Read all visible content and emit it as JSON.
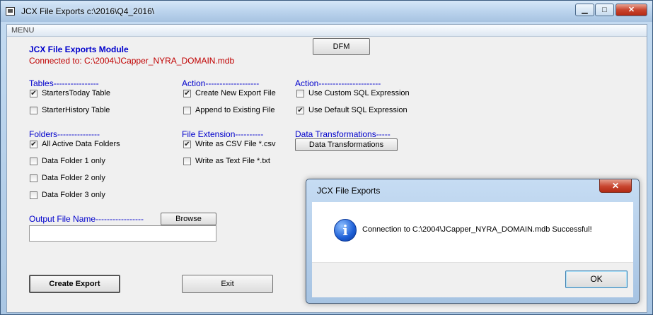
{
  "window": {
    "title": "JCX File Exports c:\\2016\\Q4_2016\\",
    "controls": {
      "minimize": "▁",
      "maximize": "□",
      "close": "✕"
    }
  },
  "menu": {
    "label": "MENU"
  },
  "module": {
    "title": "JCX File Exports Module",
    "connected": "Connected to: C:\\2004\\JCapper_NYRA_DOMAIN.mdb",
    "dfm_button": "DFM"
  },
  "tables": {
    "heading": "Tables----------------",
    "items": [
      {
        "label": "StartersToday Table",
        "checked": true
      },
      {
        "label": "StarterHistory Table",
        "checked": false
      }
    ]
  },
  "action1": {
    "heading": "Action-------------------",
    "items": [
      {
        "label": "Create New Export File",
        "checked": true
      },
      {
        "label": "Append to Existing File",
        "checked": false
      }
    ]
  },
  "action2": {
    "heading": "Action----------------------",
    "items": [
      {
        "label": "Use Custom SQL Expression",
        "checked": false
      },
      {
        "label": "Use Default SQL Expression",
        "checked": true
      }
    ]
  },
  "folders": {
    "heading": "Folders---------------",
    "items": [
      {
        "label": "All Active Data Folders",
        "checked": true
      },
      {
        "label": "Data Folder 1 only",
        "checked": false
      },
      {
        "label": "Data Folder 2 only",
        "checked": false
      },
      {
        "label": "Data Folder 3 only",
        "checked": false
      }
    ]
  },
  "file_extension": {
    "heading": "File Extension----------",
    "items": [
      {
        "label": "Write as CSV File  *.csv",
        "checked": true
      },
      {
        "label": "Write as Text File *.txt",
        "checked": false
      }
    ]
  },
  "transformations": {
    "heading": "Data Transformations-----",
    "button": "Data Transformations"
  },
  "output": {
    "label": "Output File Name-----------------",
    "browse_button": "Browse",
    "value": ""
  },
  "buttons": {
    "create_export": "Create Export",
    "exit": "Exit"
  },
  "dialog": {
    "title": "JCX File Exports",
    "close": "✕",
    "icon": "i",
    "message": "Connection to C:\\2004\\JCapper_NYRA_DOMAIN.mdb Successful!",
    "ok": "OK"
  }
}
